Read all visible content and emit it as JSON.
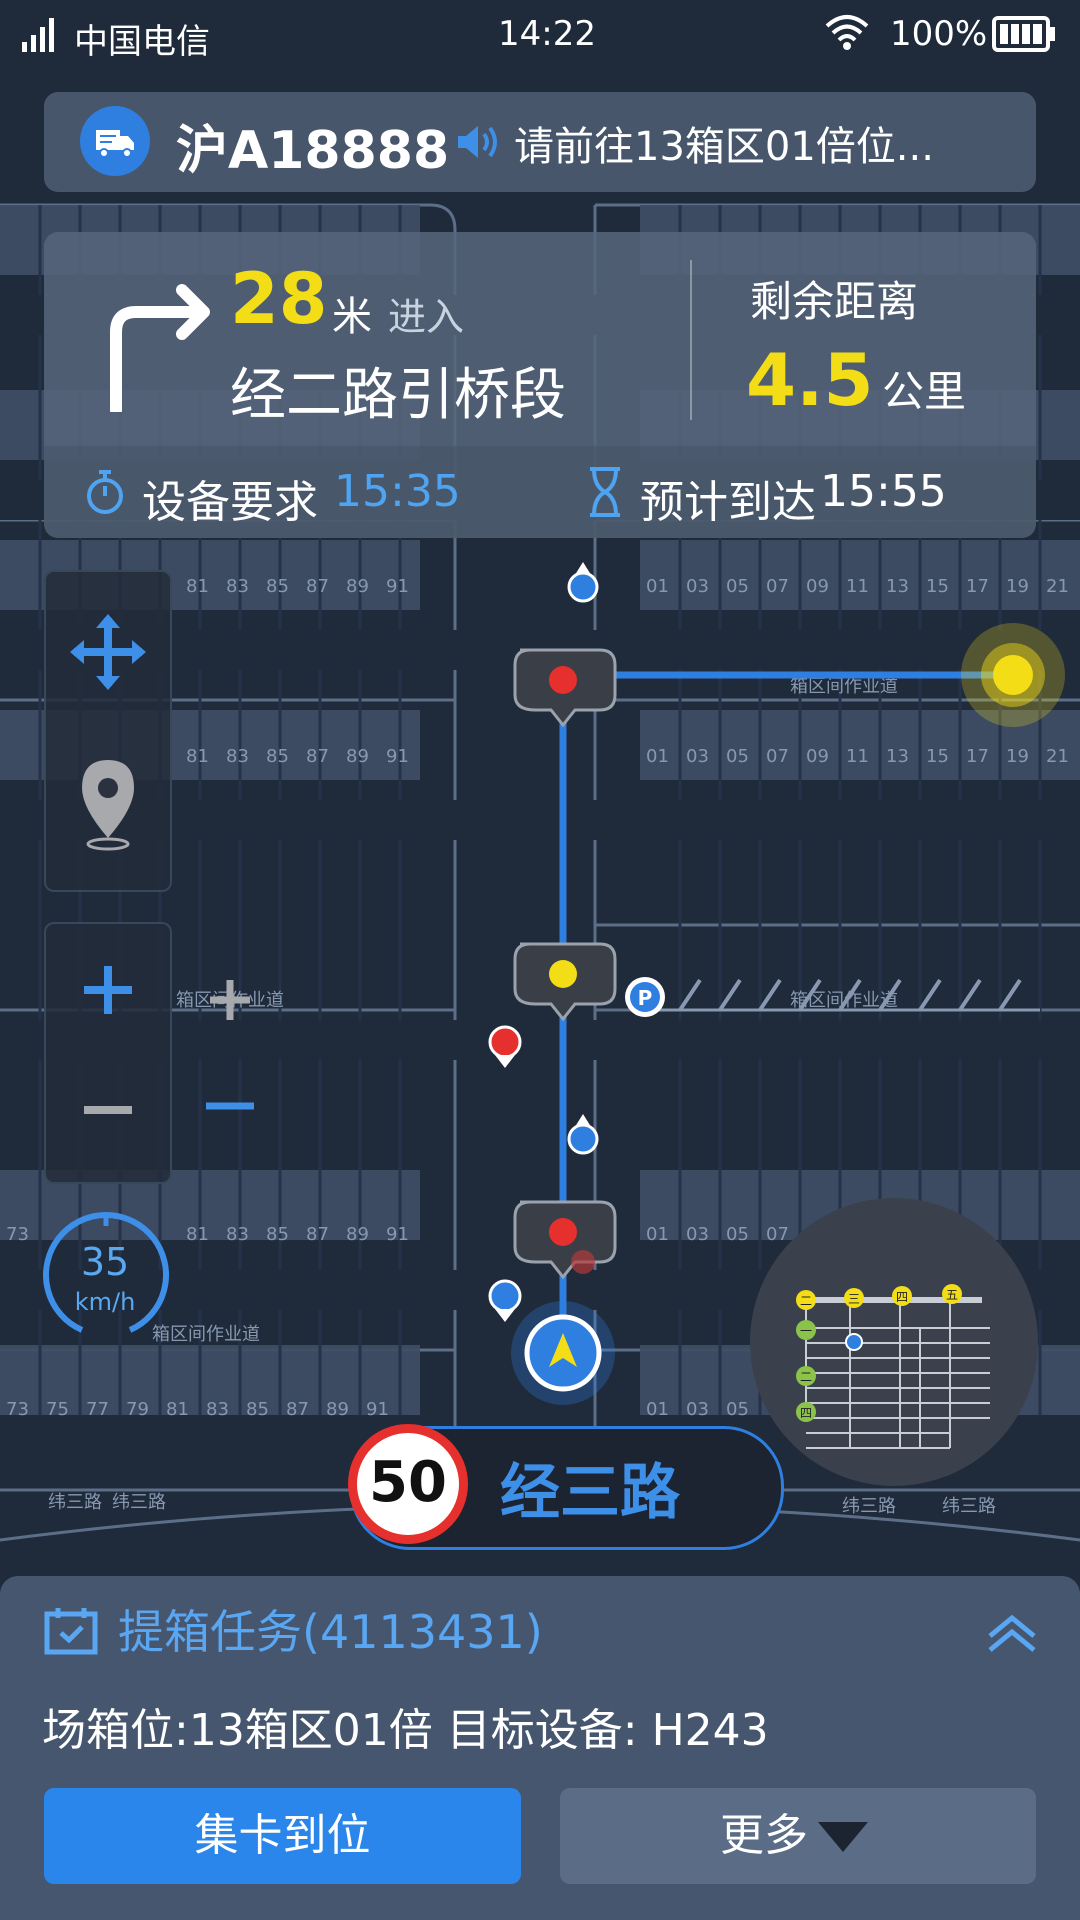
{
  "status_bar": {
    "carrier": "中国电信",
    "time": "14:22",
    "battery": "100%"
  },
  "top_bar": {
    "plate": "沪A18888",
    "instruction": "请前往13箱区01倍位..."
  },
  "nav": {
    "distance": "28",
    "distance_unit": "米",
    "enter": "进入",
    "next_road": "经二路引桥段",
    "remaining_label": "剩余距离",
    "remaining_value": "4.5",
    "remaining_unit": "公里",
    "device_req_label": "设备要求",
    "device_req_time": "15:35",
    "eta_label": "预计到达",
    "eta_time": "15:55"
  },
  "speed": {
    "value": "35",
    "unit": "km/h"
  },
  "road_sign": {
    "limit": "50",
    "current_road": "经三路"
  },
  "map": {
    "work_road_labels": [
      "箱区间作业道",
      "箱区间作业道",
      "箱区间作业道",
      "箱区间作业道"
    ],
    "road_labels": [
      "纬三路",
      "纬三路",
      "纬三路",
      "纬三路"
    ],
    "bay_numbers_left": [
      "73",
      "75",
      "77",
      "79",
      "81",
      "83",
      "85",
      "87",
      "89",
      "91"
    ],
    "bay_numbers_right": [
      "01",
      "03",
      "05",
      "07",
      "09",
      "11",
      "13",
      "15",
      "17",
      "19",
      "21"
    ],
    "parking": "P",
    "minimap_labels": [
      "二",
      "三",
      "四",
      "五",
      "一",
      "二",
      "四"
    ]
  },
  "task": {
    "title": "提箱任务(4113431)",
    "info": "场箱位:13箱区01倍   目标设备: H243",
    "confirm_button": "集卡到位",
    "more_button": "更多"
  },
  "colors": {
    "accent": "#2a86ea",
    "highlight": "#f3dd16",
    "alert": "#e6302e"
  }
}
